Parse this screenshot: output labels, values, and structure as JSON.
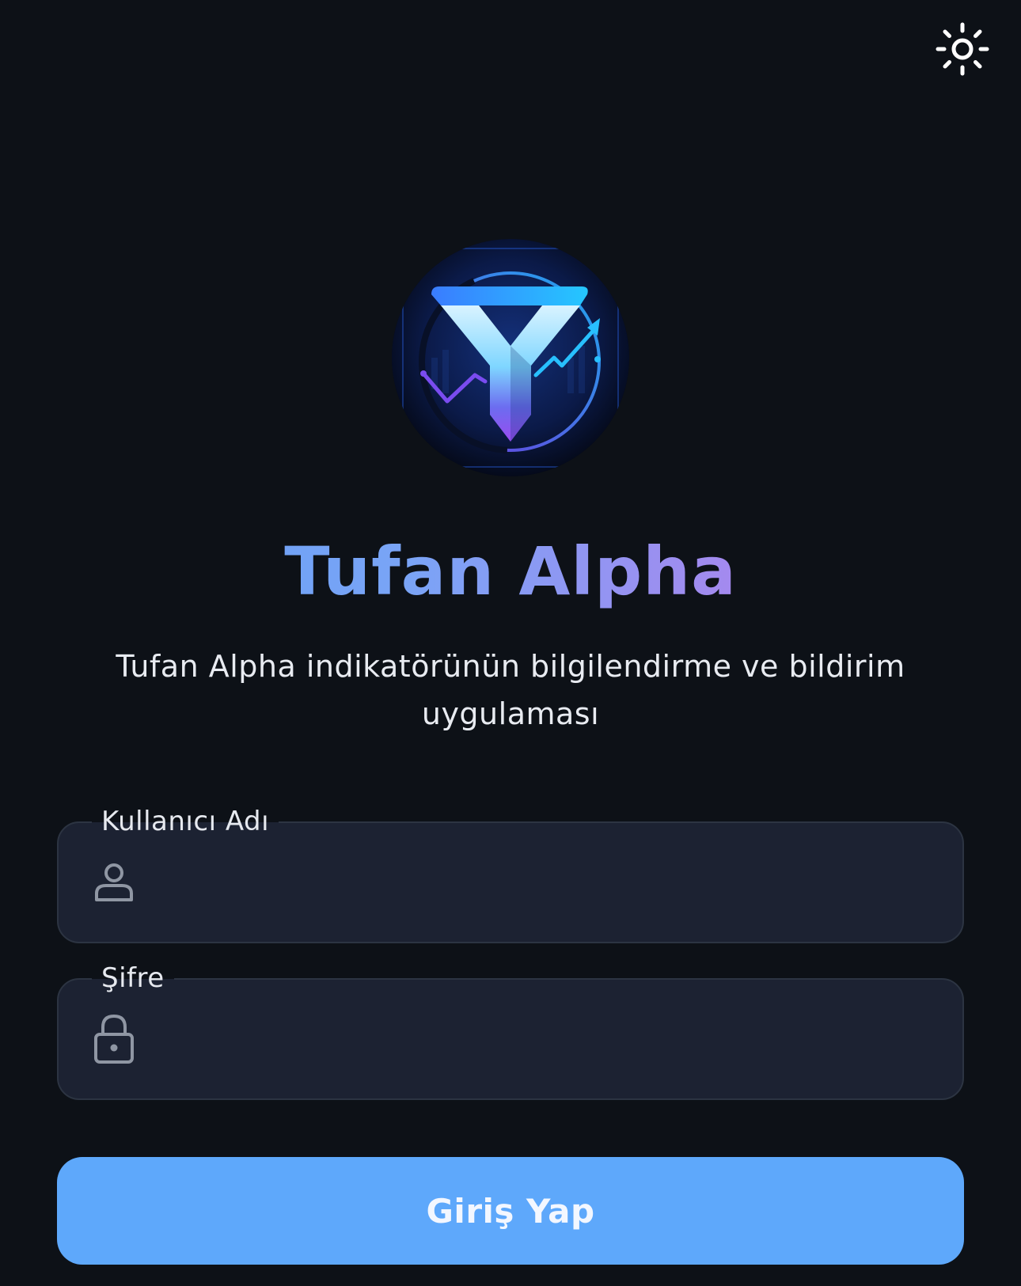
{
  "header": {
    "theme_toggle_icon": "sun-icon"
  },
  "brand": {
    "logo_icon": "tufan-alpha-logo",
    "title": "Tufan Alpha",
    "subtitle": "Tufan Alpha indikatörünün bilgilendirme ve bildirim uygulaması",
    "title_gradient": [
      "#5f9ff7",
      "#c08ef0"
    ]
  },
  "form": {
    "username": {
      "label": "Kullanıcı Adı",
      "icon": "user-icon",
      "value": ""
    },
    "password": {
      "label": "Şifre",
      "icon": "lock-icon",
      "value": ""
    },
    "submit_label": "Giriş Yap"
  },
  "colors": {
    "background": "#0d1117",
    "field_background": "#1c2232",
    "field_border": "#2c3442",
    "button": "#5ea8fb",
    "icon_muted": "#8f96a3"
  }
}
